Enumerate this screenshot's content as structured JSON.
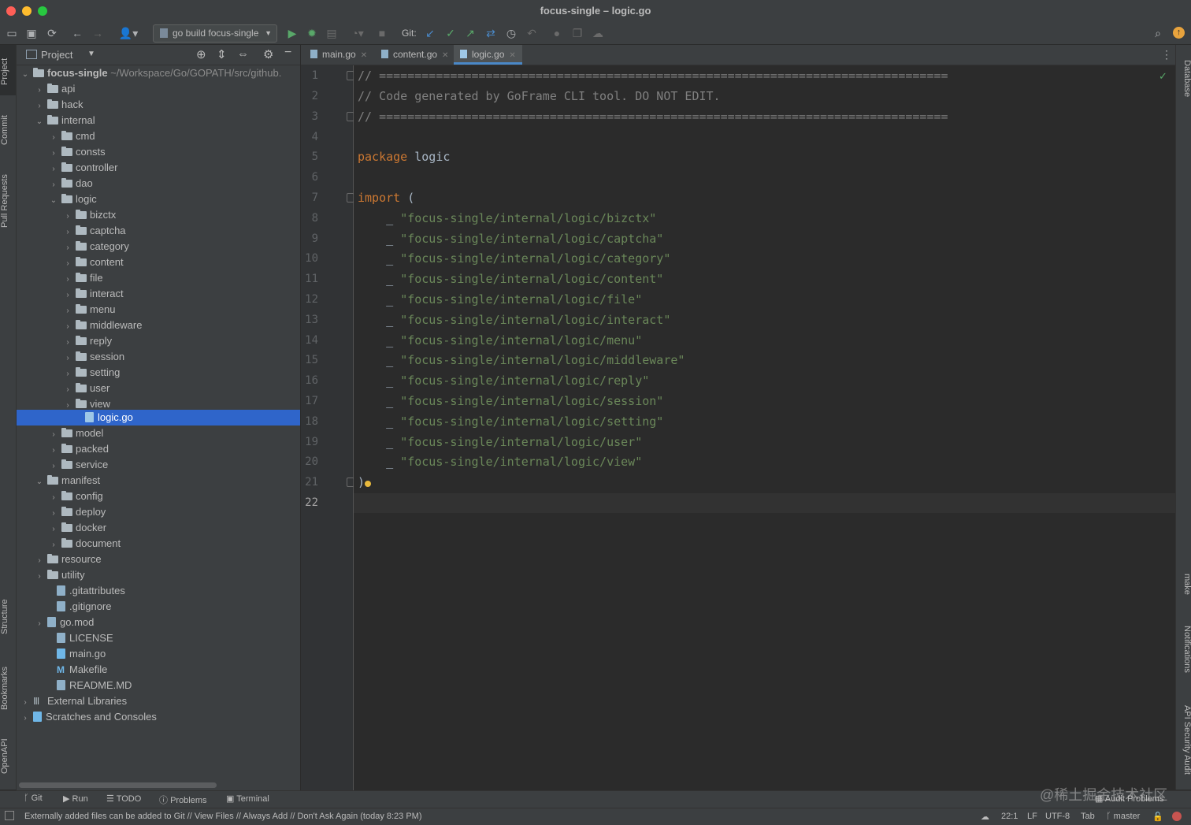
{
  "window": {
    "title": "focus-single – logic.go"
  },
  "toolbar": {
    "run_config": "go build focus-single",
    "git_label": "Git:"
  },
  "left_strip": {
    "project": "Project",
    "commit": "Commit",
    "pull_requests": "Pull Requests",
    "structure": "Structure",
    "bookmarks": "Bookmarks",
    "openapi": "OpenAPI"
  },
  "right_strip": {
    "database": "Database",
    "make": "make",
    "notifications": "Notifications",
    "api_security": "API Security Audit"
  },
  "project": {
    "title": "Project",
    "tree": [
      {
        "label": "focus-single",
        "path": "~/Workspace/Go/GOPATH/src/github.",
        "arrow": "⌄"
      },
      {
        "label": "api",
        "arrow": "›"
      },
      {
        "label": "hack",
        "arrow": "›"
      },
      {
        "label": "internal",
        "arrow": "⌄"
      },
      {
        "label": "cmd",
        "arrow": "›"
      },
      {
        "label": "consts",
        "arrow": "›"
      },
      {
        "label": "controller",
        "arrow": "›"
      },
      {
        "label": "dao",
        "arrow": "›"
      },
      {
        "label": "logic",
        "arrow": "⌄"
      },
      {
        "label": "bizctx",
        "arrow": "›"
      },
      {
        "label": "captcha",
        "arrow": "›"
      },
      {
        "label": "category",
        "arrow": "›"
      },
      {
        "label": "content",
        "arrow": "›"
      },
      {
        "label": "file",
        "arrow": "›"
      },
      {
        "label": "interact",
        "arrow": "›"
      },
      {
        "label": "menu",
        "arrow": "›"
      },
      {
        "label": "middleware",
        "arrow": "›"
      },
      {
        "label": "reply",
        "arrow": "›"
      },
      {
        "label": "session",
        "arrow": "›"
      },
      {
        "label": "setting",
        "arrow": "›"
      },
      {
        "label": "user",
        "arrow": "›"
      },
      {
        "label": "view",
        "arrow": "›"
      },
      {
        "label": "logic.go",
        "arrow": ""
      },
      {
        "label": "model",
        "arrow": "›"
      },
      {
        "label": "packed",
        "arrow": "›"
      },
      {
        "label": "service",
        "arrow": "›"
      },
      {
        "label": "manifest",
        "arrow": "⌄"
      },
      {
        "label": "config",
        "arrow": "›"
      },
      {
        "label": "deploy",
        "arrow": "›"
      },
      {
        "label": "docker",
        "arrow": "›"
      },
      {
        "label": "document",
        "arrow": "›"
      },
      {
        "label": "resource",
        "arrow": "›"
      },
      {
        "label": "utility",
        "arrow": "›"
      },
      {
        "label": ".gitattributes",
        "arrow": ""
      },
      {
        "label": ".gitignore",
        "arrow": ""
      },
      {
        "label": "go.mod",
        "arrow": "›"
      },
      {
        "label": "LICENSE",
        "arrow": ""
      },
      {
        "label": "main.go",
        "arrow": ""
      },
      {
        "label": "Makefile",
        "arrow": ""
      },
      {
        "label": "README.MD",
        "arrow": ""
      },
      {
        "label": "External Libraries",
        "arrow": "›"
      },
      {
        "label": "Scratches and Consoles",
        "arrow": "›"
      }
    ]
  },
  "editor": {
    "tabs": [
      {
        "label": "main.go"
      },
      {
        "label": "content.go"
      },
      {
        "label": "logic.go"
      }
    ],
    "line_numbers": [
      "1",
      "2",
      "3",
      "4",
      "5",
      "6",
      "7",
      "8",
      "9",
      "10",
      "11",
      "12",
      "13",
      "14",
      "15",
      "16",
      "17",
      "18",
      "19",
      "20",
      "21",
      "22"
    ],
    "code": {
      "l1": "// ================================================================================",
      "l2": "// Code generated by GoFrame CLI tool. DO NOT EDIT.",
      "l3": "// ================================================================================",
      "l5_kw": "package",
      "l5_rest": " logic",
      "l7_kw": "import",
      "l7_rest": " (",
      "l8": "\"focus-single/internal/logic/bizctx\"",
      "l9": "\"focus-single/internal/logic/captcha\"",
      "l10": "\"focus-single/internal/logic/category\"",
      "l11": "\"focus-single/internal/logic/content\"",
      "l12": "\"focus-single/internal/logic/file\"",
      "l13": "\"focus-single/internal/logic/interact\"",
      "l14": "\"focus-single/internal/logic/menu\"",
      "l15": "\"focus-single/internal/logic/middleware\"",
      "l16": "\"focus-single/internal/logic/reply\"",
      "l17": "\"focus-single/internal/logic/session\"",
      "l18": "\"focus-single/internal/logic/setting\"",
      "l19": "\"focus-single/internal/logic/user\"",
      "l20": "\"focus-single/internal/logic/view\"",
      "l21": ")",
      "blank_prefix": "    _ "
    }
  },
  "bottom_tools": {
    "git": "Git",
    "run": "Run",
    "todo": "TODO",
    "problems": "Problems",
    "terminal": "Terminal",
    "audit": "Audit Problems"
  },
  "status": {
    "message": "Externally added files can be added to Git // View Files // Always Add // Don't Ask Again (today 8:23 PM)",
    "position": "22:1",
    "line_sep": "LF",
    "encoding": "UTF-8",
    "indent": "Tab",
    "branch": "master"
  },
  "watermark": "@稀土掘金技术社区",
  "colors": {
    "selection": "#2f65ca",
    "keyword": "#cc7832",
    "string": "#6a8759",
    "comment": "#808080",
    "run_green": "#59a869"
  }
}
